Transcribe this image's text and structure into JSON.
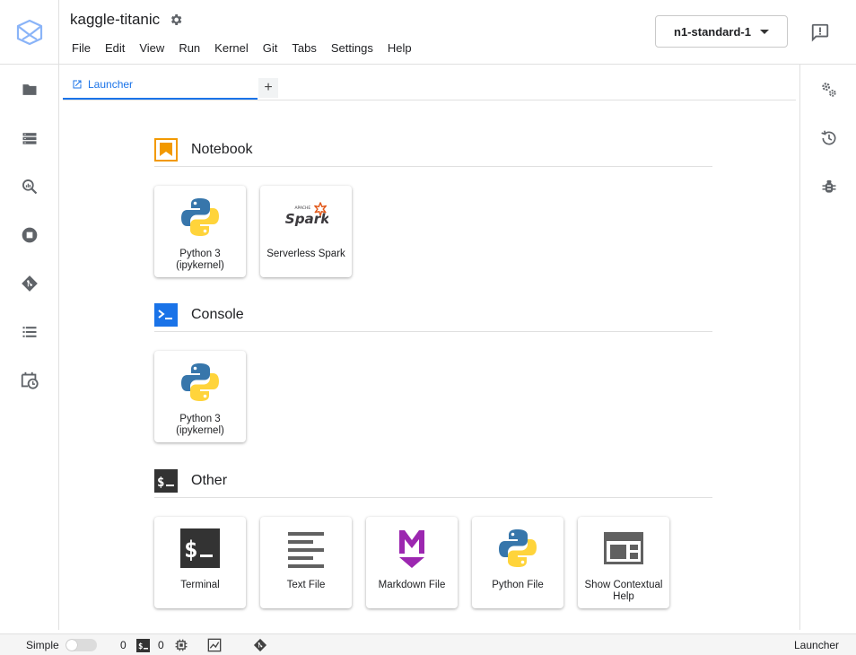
{
  "header": {
    "title": "kaggle-titanic",
    "machine_type": "n1-standard-1",
    "menu": [
      "File",
      "Edit",
      "View",
      "Run",
      "Kernel",
      "Git",
      "Tabs",
      "Settings",
      "Help"
    ]
  },
  "tab": {
    "label": "Launcher",
    "add_label": "+"
  },
  "sections": {
    "notebook": {
      "label": "Notebook",
      "cards": [
        "Python 3\n(ipykernel)",
        "Serverless Spark"
      ]
    },
    "console": {
      "label": "Console",
      "cards": [
        "Python 3\n(ipykernel)"
      ]
    },
    "other": {
      "label": "Other",
      "cards": [
        "Terminal",
        "Text File",
        "Markdown File",
        "Python File",
        "Show Contextual Help"
      ]
    }
  },
  "statusbar": {
    "mode_label": "Simple",
    "kernels_count": "0",
    "terminals_count": "0",
    "right_label": "Launcher"
  },
  "icons": {
    "left_bar": [
      "folder-icon",
      "running-list-icon",
      "search-icon",
      "stop-circle-icon",
      "git-icon",
      "table-of-contents-icon",
      "schedule-icon"
    ],
    "right_bar": [
      "property-inspector-icon",
      "history-icon",
      "debugger-icon"
    ]
  },
  "colors": {
    "accent": "#1a73e8",
    "notebook_orange": "#f29900",
    "python_blue": "#3776ab",
    "python_yellow": "#ffd43b",
    "markdown_purple": "#9c27b0",
    "spark_orange": "#e25a1c"
  }
}
